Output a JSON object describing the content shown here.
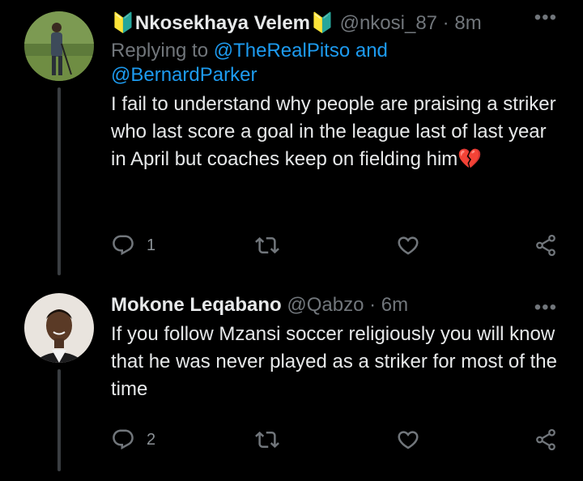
{
  "tweets": [
    {
      "name": "🔰Nkosekhaya Velem🔰",
      "handle": "@nkosi_87",
      "time": "8m",
      "replying_prefix": "Replying to ",
      "replying_to_1": "@TheRealPitso",
      "replying_and": " and",
      "replying_to_2": "@BernardParker",
      "text": "I fail to understand why people are praising a striker who last score a goal in the league last of last year in April but coaches keep on fielding him",
      "emoji": "💔",
      "reply_count": "1",
      "more_glyph": "•••"
    },
    {
      "name": "Mokone Leqabano",
      "handle": "@Qabzo",
      "time": "6m",
      "text": "If you follow Mzansi soccer religiously you will know that he was never played as a striker for most of the time",
      "reply_count": "2",
      "more_glyph": "•••"
    }
  ],
  "separator": " · ",
  "icons": [
    "reply-icon",
    "retweet-icon",
    "like-icon",
    "share-icon",
    "more-icon"
  ],
  "colors": {
    "background": "#000000",
    "link": "#1d9bf0",
    "muted": "#71767b",
    "text": "#e7e9ea",
    "broken_heart": "#e0245e"
  }
}
